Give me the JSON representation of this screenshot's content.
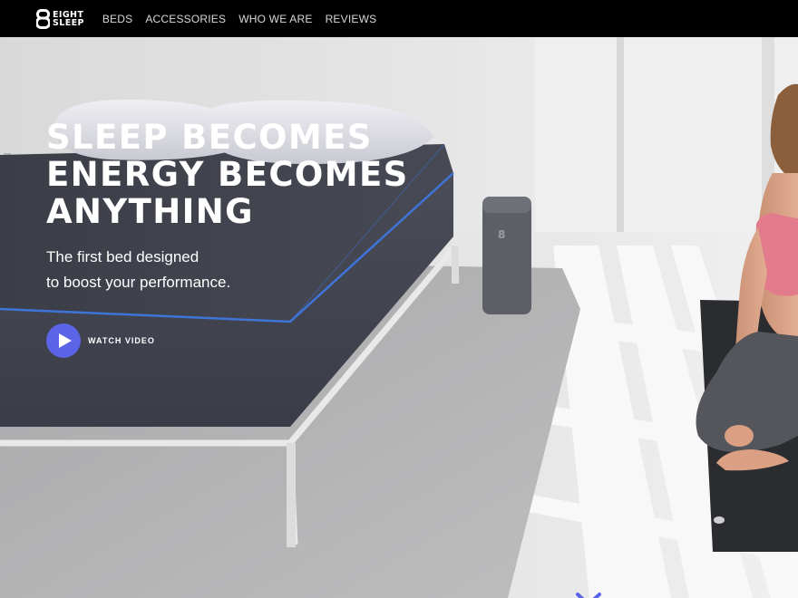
{
  "brand": {
    "logo_line1": "EIGHT",
    "logo_line2": "SLEEP"
  },
  "nav": {
    "items": [
      {
        "label": "BEDS"
      },
      {
        "label": "ACCESSORIES"
      },
      {
        "label": "WHO WE ARE"
      },
      {
        "label": "REVIEWS"
      }
    ]
  },
  "hero": {
    "headline_lines": [
      "SLEEP BECOMES",
      "ENERGY BECOMES",
      "ANYTHING"
    ],
    "subline_lines": [
      "The first bed designed",
      "to boost your performance."
    ],
    "watch_label": "WATCH VIDEO"
  },
  "icons": {
    "logo": "eight-logo-icon",
    "play": "play-icon",
    "scroll": "chevron-down-icon"
  },
  "colors": {
    "nav_bg": "#000000",
    "accent": "#5b63e6",
    "mattress": "#3d3f4a",
    "floor": "#e4e4e4"
  }
}
